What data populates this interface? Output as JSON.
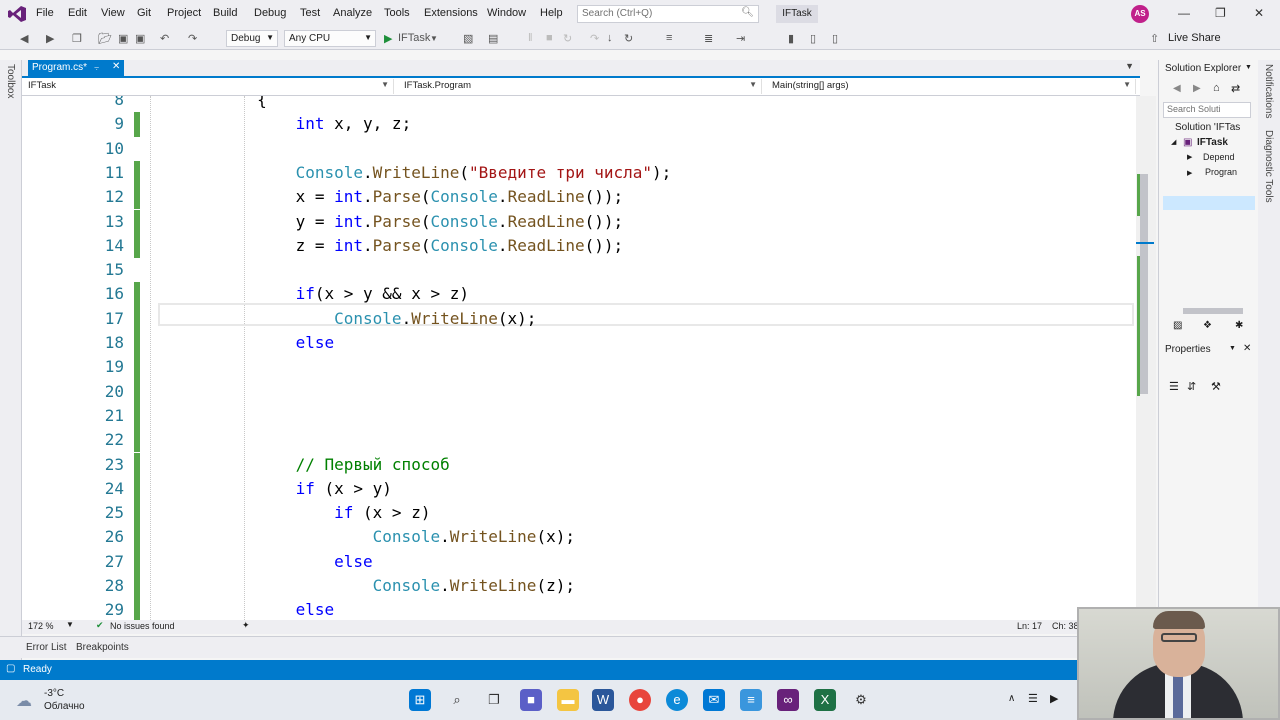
{
  "menubar": {
    "items": [
      "File",
      "Edit",
      "View",
      "Git",
      "Project",
      "Build",
      "Debug",
      "Test",
      "Analyze",
      "Tools",
      "Extensions",
      "Window",
      "Help"
    ],
    "search_placeholder": "Search (Ctrl+Q)",
    "solution_name": "IFTask",
    "avatar_initials": "AS"
  },
  "toolbar": {
    "config": "Debug",
    "platform": "Any CPU",
    "run_target": "IFTask",
    "live_share": "Live Share"
  },
  "left_strip": {
    "label": "Toolbox"
  },
  "tabs": {
    "active": "Program.cs*"
  },
  "navbar": {
    "project": "IFTask",
    "class": "IFTask.Program",
    "member": "Main(string[] args)"
  },
  "editor": {
    "lines": [
      {
        "n": "8",
        "tokens": [
          [
            "p",
            "        {"
          ]
        ]
      },
      {
        "n": "9",
        "tokens": [
          [
            "p",
            "            "
          ],
          [
            "kw",
            "int"
          ],
          [
            "p",
            " x, y, z;"
          ]
        ]
      },
      {
        "n": "10",
        "tokens": []
      },
      {
        "n": "11",
        "tokens": [
          [
            "p",
            "            "
          ],
          [
            "ty",
            "Console"
          ],
          [
            "p",
            "."
          ],
          [
            "fn",
            "WriteLine"
          ],
          [
            "p",
            "("
          ],
          [
            "st",
            "\"Введите три числа\""
          ],
          [
            "p",
            ");"
          ]
        ]
      },
      {
        "n": "12",
        "tokens": [
          [
            "p",
            "            x = "
          ],
          [
            "kw",
            "int"
          ],
          [
            "p",
            "."
          ],
          [
            "fn",
            "Parse"
          ],
          [
            "p",
            "("
          ],
          [
            "ty",
            "Console"
          ],
          [
            "p",
            "."
          ],
          [
            "fn",
            "ReadLine"
          ],
          [
            "p",
            "());"
          ]
        ]
      },
      {
        "n": "13",
        "tokens": [
          [
            "p",
            "            y = "
          ],
          [
            "kw",
            "int"
          ],
          [
            "p",
            "."
          ],
          [
            "fn",
            "Parse"
          ],
          [
            "p",
            "("
          ],
          [
            "ty",
            "Console"
          ],
          [
            "p",
            "."
          ],
          [
            "fn",
            "ReadLine"
          ],
          [
            "p",
            "());"
          ]
        ]
      },
      {
        "n": "14",
        "tokens": [
          [
            "p",
            "            z = "
          ],
          [
            "kw",
            "int"
          ],
          [
            "p",
            "."
          ],
          [
            "fn",
            "Parse"
          ],
          [
            "p",
            "("
          ],
          [
            "ty",
            "Console"
          ],
          [
            "p",
            "."
          ],
          [
            "fn",
            "ReadLine"
          ],
          [
            "p",
            "());"
          ]
        ]
      },
      {
        "n": "15",
        "tokens": []
      },
      {
        "n": "16",
        "tokens": [
          [
            "p",
            "            "
          ],
          [
            "kw",
            "if"
          ],
          [
            "p",
            "(x > y && x > z)"
          ]
        ]
      },
      {
        "n": "17",
        "tokens": [
          [
            "p",
            "                "
          ],
          [
            "ty",
            "Console"
          ],
          [
            "p",
            "."
          ],
          [
            "fn",
            "WriteLine"
          ],
          [
            "p",
            "(x);"
          ]
        ]
      },
      {
        "n": "18",
        "tokens": [
          [
            "p",
            "            "
          ],
          [
            "kw",
            "else"
          ]
        ]
      },
      {
        "n": "19",
        "tokens": []
      },
      {
        "n": "20",
        "tokens": []
      },
      {
        "n": "21",
        "tokens": []
      },
      {
        "n": "22",
        "tokens": []
      },
      {
        "n": "23",
        "tokens": [
          [
            "p",
            "            "
          ],
          [
            "cm",
            "// Первый способ"
          ]
        ]
      },
      {
        "n": "24",
        "tokens": [
          [
            "p",
            "            "
          ],
          [
            "kw",
            "if"
          ],
          [
            "p",
            " (x > y)"
          ]
        ]
      },
      {
        "n": "25",
        "tokens": [
          [
            "p",
            "                "
          ],
          [
            "kw",
            "if"
          ],
          [
            "p",
            " (x > z)"
          ]
        ]
      },
      {
        "n": "26",
        "tokens": [
          [
            "p",
            "                    "
          ],
          [
            "ty",
            "Console"
          ],
          [
            "p",
            "."
          ],
          [
            "fn",
            "WriteLine"
          ],
          [
            "p",
            "(x);"
          ]
        ]
      },
      {
        "n": "27",
        "tokens": [
          [
            "p",
            "                "
          ],
          [
            "kw",
            "else"
          ]
        ]
      },
      {
        "n": "28",
        "tokens": [
          [
            "p",
            "                    "
          ],
          [
            "ty",
            "Console"
          ],
          [
            "p",
            "."
          ],
          [
            "fn",
            "WriteLine"
          ],
          [
            "p",
            "(z);"
          ]
        ]
      },
      {
        "n": "29",
        "tokens": [
          [
            "p",
            "            "
          ],
          [
            "kw",
            "else"
          ]
        ]
      }
    ]
  },
  "editor_status": {
    "zoom": "172 %",
    "issues": "No issues found",
    "line": "Ln: 17",
    "col": "Ch: 38"
  },
  "bottom_tabs": [
    "Error List",
    "Breakpoints"
  ],
  "statusbar": {
    "text": "Ready"
  },
  "solution_explorer": {
    "title": "Solution Explorer",
    "search_placeholder": "Search Soluti",
    "tree": [
      "Solution 'IFTas",
      "IFTask",
      "Depend",
      "Progran"
    ]
  },
  "properties": {
    "title": "Properties"
  },
  "right_strip": [
    "Notifications",
    "Diagnostic Tools"
  ],
  "weather": {
    "temp": "-3°C",
    "desc": "Облачно"
  },
  "colors": {
    "accent": "#007acc",
    "keyword": "#0000ff",
    "type": "#2b91af",
    "string": "#a31515",
    "comment": "#008000",
    "change_bar": "#57a64a"
  }
}
